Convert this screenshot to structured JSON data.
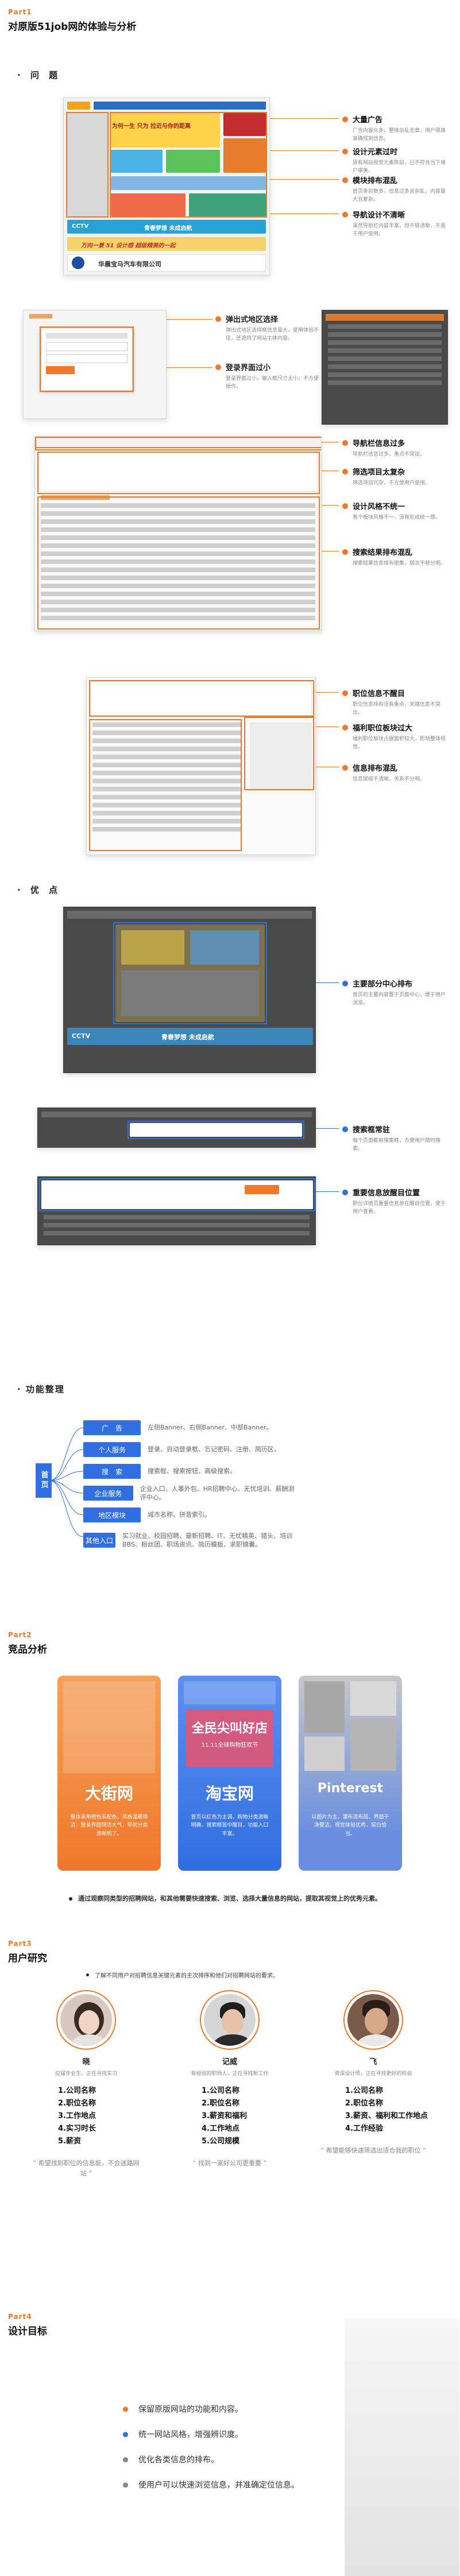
{
  "part1": {
    "tag": "Part1",
    "title": "对原版51job网的体验与分析"
  },
  "problems": {
    "heading": "· 问  题",
    "shot1": {
      "banner_top": "为何一生 只为 拉近与你的距离",
      "banner_mid": "青春梦想   未成启航",
      "cctv": "CCTV",
      "banner_bottom": "万向一景 51 设计感 超级精美的一起",
      "footer": "华晨宝马汽车有限公司"
    },
    "notes1": [
      {
        "title": "大量广告",
        "desc": "广告内容众多，整体杂乱无章，用户很难准确找到信息。"
      },
      {
        "title": "设计元素过时",
        "desc": "原有网站视觉元素陈旧，已不符合当下用户审美。"
      },
      {
        "title": "模块排布混乱",
        "desc": "首页条目数多，信息过多且杂乱，内容量大且复杂。"
      },
      {
        "title": "导航设计不清晰",
        "desc": "虽然导航栏内容丰富，但不够清晰，不易于用户使用。"
      }
    ],
    "notes2": [
      {
        "title": "弹出式地区选择",
        "desc": "弹出式地区选择框信息量大，使用体验不佳，还遮挡了网站主体内容。"
      },
      {
        "title": "登录界面过小",
        "desc": "登录界面过小，输入框尺寸太小，不方便操作。"
      }
    ],
    "notes3": [
      {
        "title": "导航栏信息过多",
        "desc": "导航栏信息过多，重点不突出。"
      },
      {
        "title": "筛选项目太复杂",
        "desc": "筛选项目冗杂，不方便用户使用。"
      },
      {
        "title": "设计风格不统一",
        "desc": "各个板块风格不一，没有形成统一感。"
      },
      {
        "title": "搜索结果排布混乱",
        "desc": "搜索结果信息排布密集，层次不够分明。"
      }
    ],
    "notes4": [
      {
        "title": "职位信息不醒目",
        "desc": "职位信息排布没有重点，关键信息不突出。"
      },
      {
        "title": "福利职位板块过大",
        "desc": "福利职位板块占据面积较大，影响整体视觉。"
      },
      {
        "title": "信息排布混乱",
        "desc": "信息层级不清晰，关系不分明。"
      }
    ]
  },
  "merits": {
    "heading": "· 优  点",
    "notes": [
      {
        "title": "主要部分中心排布",
        "desc": "首页的主要内容置于页面中心，便于用户浏览。"
      },
      {
        "title": "搜索框常驻",
        "desc": "每个页面都有搜索框，方便用户随时搜索。"
      },
      {
        "title": "重要信息放醒目位置",
        "desc": "职位详情页重要信息放在醒目位置，便于用户查看。"
      }
    ]
  },
  "functions": {
    "heading": "· 功能整理",
    "center": "首页",
    "items": [
      {
        "tag": "广　告",
        "text": "左侧Banner、右侧Banner、中部Banner。"
      },
      {
        "tag": "个人服务",
        "text": "登录、自动登录框、忘记密码、注册、简历区。"
      },
      {
        "tag": "搜　索",
        "text": "搜索框、搜索按钮、高级搜索。"
      },
      {
        "tag": "企业服务",
        "text": "企业入口、人事外包、HR招聘中心、无忧培训、薪酬测评中心。"
      },
      {
        "tag": "地区模块",
        "text": "城市名称、拼音索引。"
      },
      {
        "tag": "其他入口",
        "text": "实习就业、校园招聘、最新招聘、IT、无忧精英、猎头、培训BBS、粉丝团、职场资讯、简历模板、求职锦囊。"
      }
    ]
  },
  "part2": {
    "tag": "Part2",
    "title": "竞品分析",
    "cards": [
      {
        "name": "大街网",
        "desc": "整体采用橙色系配色，风格温暖简洁，登录界面简洁大气，导航分类清晰明了。"
      },
      {
        "name": "淘宝网",
        "desc": "首页以红色为主调，购物分类清晰明确，搜索框居中醒目，功能入口丰富。",
        "poster": "全民尖叫好店",
        "poster_sub": "11.11全球购物狂欢节"
      },
      {
        "name": "Pinterest",
        "desc": "以图片为主，瀑布流布局，界面干净整洁，视觉体验优秀，留白恰当。"
      }
    ],
    "summary": "通过观察同类型的招聘网站，和其他需要快速搜索、浏览、选择大量信息的网站，提取其视觉上的优秀元素。"
  },
  "part3": {
    "tag": "Part3",
    "title": "用户研究",
    "intro": "了解不同用户对招聘信息关键元素的主次排序和他们对招聘网站的要求。",
    "personas": [
      {
        "name": "晓",
        "desc": "应届毕业生，正在寻找实习",
        "list": [
          "1.公司名称",
          "2.职位名称",
          "3.工作地点",
          "4.实习时长",
          "5.薪资"
        ],
        "quote": "“ 希望找到职位的信息能，不会迷路网站 ”"
      },
      {
        "name": "记威",
        "desc": "有经验的职场人，正在寻找新工作",
        "list": [
          "1.公司名称",
          "2.职位名称",
          "3.薪资和福利",
          "4.工作地点",
          "5.公司规模"
        ],
        "quote": "“ 找到一家好公司更重要 ”"
      },
      {
        "name": "飞",
        "desc": "资深设计师，正在寻找更好的机会",
        "list": [
          "1.公司名称",
          "2.职位名称",
          "3.薪资、福利和工作地点",
          "4.工作经验"
        ],
        "quote": "“ 希望能够快速筛选出适合我的职位 ”"
      }
    ]
  },
  "part4": {
    "tag": "Part4",
    "title": "设计目标",
    "goals": [
      "保留原版网站的功能和内容。",
      "统一网站风格，增强辨识度。",
      "优化各类信息的排布。",
      "使用户可以快速浏览信息，并准确定位信息。"
    ],
    "goal_colors": [
      "#f0782a",
      "#2f6fe0",
      "#888888",
      "#888888"
    ]
  },
  "colors": {
    "accent": "#f0782a",
    "blue": "#2f6fe0"
  }
}
